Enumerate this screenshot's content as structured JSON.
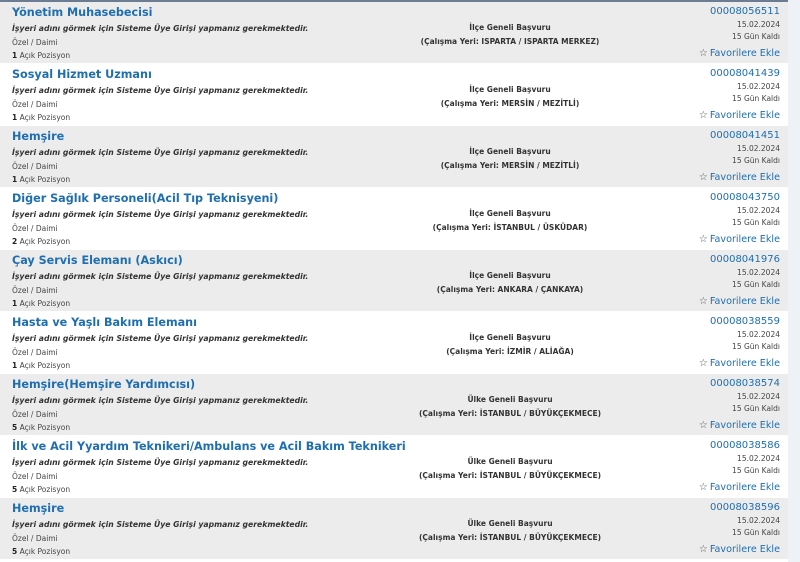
{
  "notice_text": "İşyeri adını görmek için Sisteme Üye Girişi yapmanız gerekmektedir.",
  "favorite_label": "Favorilere Ekle",
  "positions_suffix": "Açık Pozisyon",
  "listings": [
    {
      "title": "Yönetim Muhasebecisi",
      "type": "Özel / Daimi",
      "positions": "1",
      "scope": "İlçe Geneli Başvuru",
      "location": "(Çalışma Yeri: ISPARTA / ISPARTA MERKEZ)",
      "ref": "00008056511",
      "date": "15.02.2024",
      "remaining": "15 Gün Kaldı"
    },
    {
      "title": "Sosyal Hizmet Uzmanı",
      "type": "Özel / Daimi",
      "positions": "1",
      "scope": "İlçe Geneli Başvuru",
      "location": "(Çalışma Yeri: MERSİN / MEZİTLİ)",
      "ref": "00008041439",
      "date": "15.02.2024",
      "remaining": "15 Gün Kaldı"
    },
    {
      "title": "Hemşire",
      "type": "Özel / Daimi",
      "positions": "1",
      "scope": "İlçe Geneli Başvuru",
      "location": "(Çalışma Yeri: MERSİN / MEZİTLİ)",
      "ref": "00008041451",
      "date": "15.02.2024",
      "remaining": "15 Gün Kaldı"
    },
    {
      "title": "Diğer Sağlık Personeli(Acil Tıp Teknisyeni)",
      "type": "Özel / Daimi",
      "positions": "2",
      "scope": "İlçe Geneli Başvuru",
      "location": "(Çalışma Yeri: İSTANBUL / ÜSKÜDAR)",
      "ref": "00008043750",
      "date": "15.02.2024",
      "remaining": "15 Gün Kaldı"
    },
    {
      "title": "Çay Servis Elemanı (Askıcı)",
      "type": "Özel / Daimi",
      "positions": "1",
      "scope": "İlçe Geneli Başvuru",
      "location": "(Çalışma Yeri: ANKARA / ÇANKAYA)",
      "ref": "00008041976",
      "date": "15.02.2024",
      "remaining": "15 Gün Kaldı"
    },
    {
      "title": "Hasta ve Yaşlı Bakım Elemanı",
      "type": "Özel / Daimi",
      "positions": "1",
      "scope": "İlçe Geneli Başvuru",
      "location": "(Çalışma Yeri: İZMİR / ALİAĞA)",
      "ref": "00008038559",
      "date": "15.02.2024",
      "remaining": "15 Gün Kaldı"
    },
    {
      "title": "Hemşire(Hemşire Yardımcısı)",
      "type": "Özel / Daimi",
      "positions": "5",
      "scope": "Ülke Geneli Başvuru",
      "location": "(Çalışma Yeri: İSTANBUL / BÜYÜKÇEKMECE)",
      "ref": "00008038574",
      "date": "15.02.2024",
      "remaining": "15 Gün Kaldı"
    },
    {
      "title": "İlk ve Acil Yyardım Teknikeri/Ambulans ve Acil Bakım Teknikeri",
      "type": "Özel / Daimi",
      "positions": "5",
      "scope": "Ülke Geneli Başvuru",
      "location": "(Çalışma Yeri: İSTANBUL / BÜYÜKÇEKMECE)",
      "ref": "00008038586",
      "date": "15.02.2024",
      "remaining": "15 Gün Kaldı"
    },
    {
      "title": "Hemşire",
      "type": "Özel / Daimi",
      "positions": "5",
      "scope": "Ülke Geneli Başvuru",
      "location": "(Çalışma Yeri: İSTANBUL / BÜYÜKÇEKMECE)",
      "ref": "00008038596",
      "date": "15.02.2024",
      "remaining": "15 Gün Kaldı"
    }
  ]
}
